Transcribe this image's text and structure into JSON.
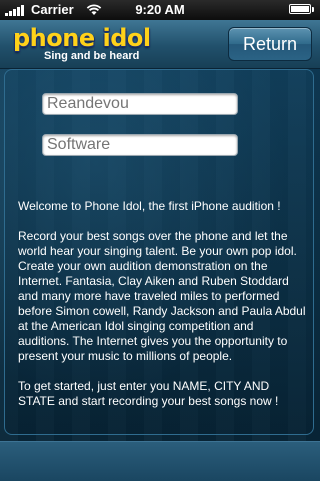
{
  "status_bar": {
    "carrier": "Carrier",
    "time": "9:20 AM",
    "battery_level": 1.0,
    "icons": [
      "signal-icon",
      "wifi-icon",
      "battery-icon"
    ]
  },
  "nav": {
    "logo_title": "phone idol",
    "logo_subtitle": "Sing and be heard",
    "return_label": "Return"
  },
  "form": {
    "name_placeholder": "Reandevou",
    "city_placeholder": "Software"
  },
  "intro": {
    "p1": "Welcome to Phone Idol, the first iPhone audition !",
    "p2": "Record your best songs over the phone and let the world hear your singing talent. Be your own pop idol. Create your own audition demonstration on the Internet. Fantasia, Clay Aiken and Ruben Stoddard and many more have traveled miles to performed before Simon cowell, Randy Jackson and Paula Abdul at the American Idol singing competition and auditions. The Internet gives you the opportunity to present your music to millions of people.",
    "p3": "To get started, just enter you NAME, CITY AND STATE and start recording your best songs now !"
  },
  "colors": {
    "logo_yellow": "#ffd21a",
    "nav_blue": "#21506b",
    "background": "#0b2a3d"
  }
}
